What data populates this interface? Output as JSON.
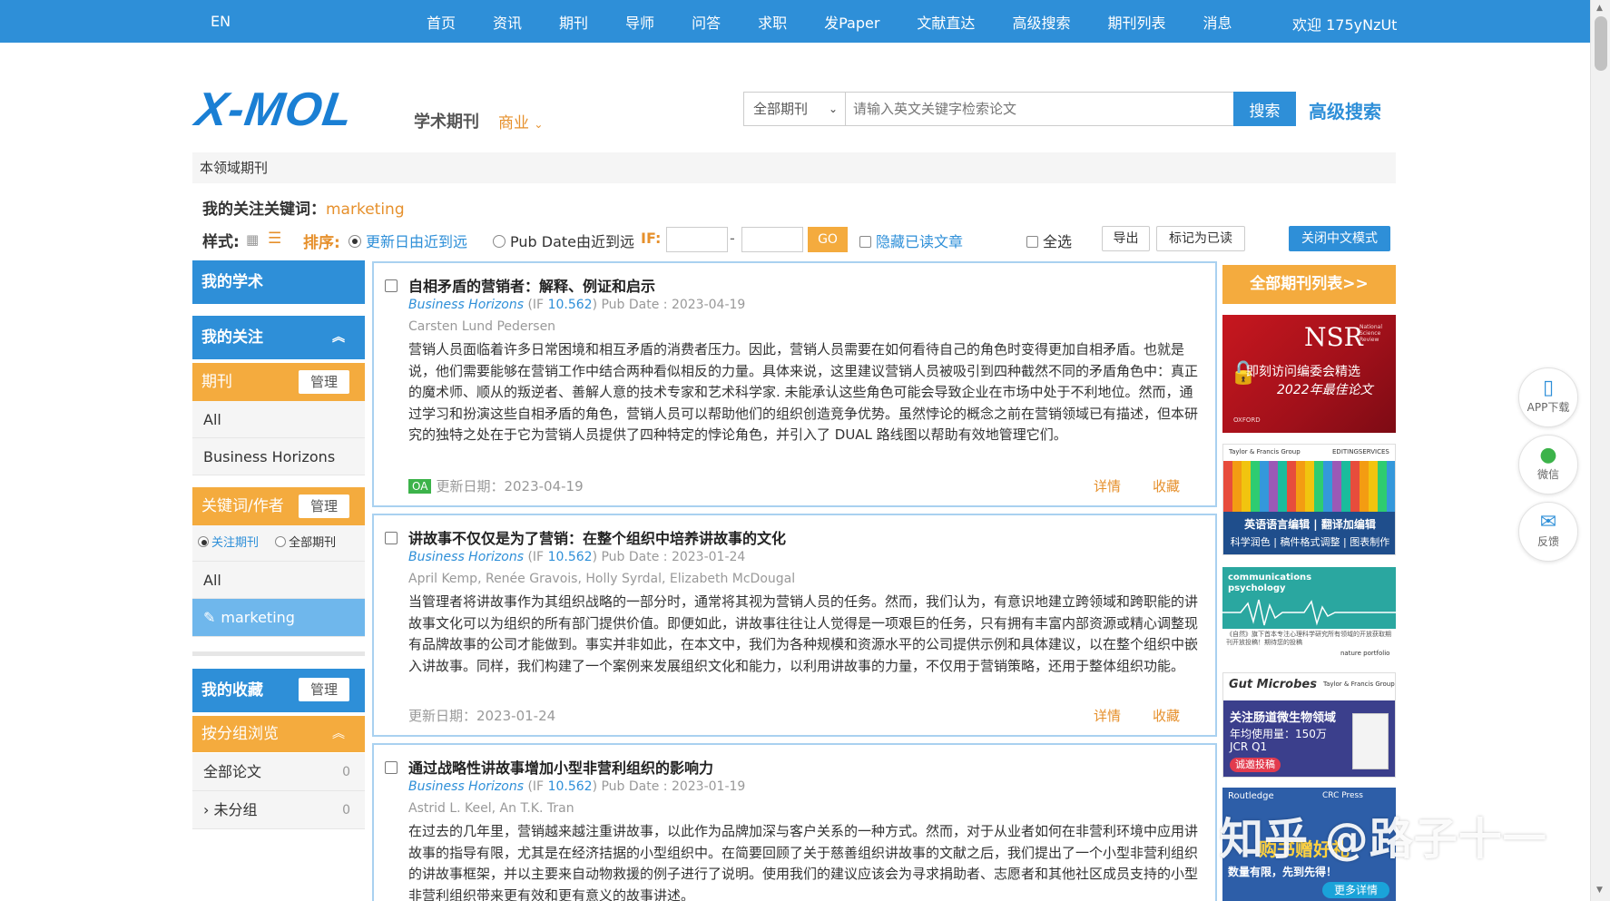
{
  "topnav": {
    "lang": "EN",
    "items": [
      "首页",
      "资讯",
      "期刊",
      "导师",
      "问答",
      "求职",
      "发Paper",
      "文献直达",
      "高级搜索",
      "期刊列表",
      "消息"
    ],
    "welcome": "欢迎 175yNzUt"
  },
  "header": {
    "logo": "X-MOL",
    "subtitle": "学术期刊",
    "category": "商业"
  },
  "search": {
    "scope": "全部期刊",
    "placeholder": "请输入英文关键字检索论文",
    "button": "搜索",
    "advanced": "高级搜索"
  },
  "field_title": "本领域期刊",
  "keyword": {
    "label": "我的关注关键词：",
    "value": "marketing"
  },
  "toolbar": {
    "style_label": "样式:",
    "sort_label": "排序:",
    "sort_update": "更新日由近到远",
    "sort_pub": "Pub Date由近到远",
    "if_label": "IF:",
    "dash": "-",
    "go": "GO",
    "hide_read": "隐藏已读文章",
    "select_all": "全选",
    "export": "导出",
    "mark_read": "标记为已读",
    "close_cn": "关闭中文模式"
  },
  "sidebar": {
    "my_academic": "我的学术",
    "my_follow": "我的关注",
    "journals_label": "期刊",
    "manage": "管理",
    "journal_items": [
      "All",
      "Business Horizons"
    ],
    "kw_label": "关键词/作者",
    "kw_radio_follow": "关注期刊",
    "kw_radio_all": "全部期刊",
    "kw_items": [
      "All",
      "marketing"
    ],
    "favorites": "我的收藏",
    "browse_group": "按分组浏览",
    "groups": [
      {
        "name": "全部论文",
        "count": "0"
      },
      {
        "name": "› 未分组",
        "count": "0"
      }
    ]
  },
  "articles": [
    {
      "title": "自相矛盾的营销者：解释、例证和启示",
      "journal": "Business Horizons",
      "if_prefix": "(IF ",
      "if": "10.562",
      "pub": ") Pub Date : 2023-04-19",
      "authors": "Carsten Lund Pedersen",
      "abstract": "营销人员面临着许多日常困境和相互矛盾的消费者压力。因此，营销人员需要在如何看待自己的角色时变得更加自相矛盾。也就是说，他们需要能够在营销工作中结合两种看似相反的力量。具体来说，这里建议营销人员被吸引到四种截然不同的矛盾角色中：真正的魔术师、顺从的叛逆者、善解人意的技术专家和艺术科学家. 未能承认这些角色可能会导致企业在市场中处于不利地位。然而，通过学习和扮演这些自相矛盾的角色，营销人员可以帮助他们的组织创造竞争优势。虽然悖论的概念之前在营销领域已有描述，但本研究的独特之处在于它为营销人员提供了四种特定的悖论角色，并引入了 DUAL 路线图以帮助有效地管理它们。",
      "oa": "OA",
      "updated": "更新日期：2023-04-19",
      "detail": "详情",
      "fav": "收藏"
    },
    {
      "title": "讲故事不仅仅是为了营销：在整个组织中培养讲故事的文化",
      "journal": "Business Horizons",
      "if_prefix": "(IF ",
      "if": "10.562",
      "pub": ") Pub Date : 2023-01-24",
      "authors": "April Kemp, Renée Gravois, Holly Syrdal, Elizabeth McDougal",
      "abstract": "当管理者将讲故事作为其组织战略的一部分时，通常将其视为营销人员的任务。然而，我们认为，有意识地建立跨领域和跨职能的讲故事文化可以为组织的所有部门提供价值。即便如此，讲故事往往让人觉得是一项艰巨的任务，只有拥有丰富内部资源或精心调整现有品牌故事的公司才能做到。事实并非如此，在本文中，我们为各种规模和资源水平的公司提供示例和具体建议，以在整个组织中嵌入讲故事。同样，我们构建了一个案例来发展组织文化和能力，以利用讲故事的力量，不仅用于营销策略，还用于整体组织功能。",
      "updated": "更新日期：2023-01-24",
      "detail": "详情",
      "fav": "收藏"
    },
    {
      "title": "通过战略性讲故事增加小型非营利组织的影响力",
      "journal": "Business Horizons",
      "if_prefix": "(IF ",
      "if": "10.562",
      "pub": ") Pub Date : 2023-01-19",
      "authors": "Astrid L. Keel, An T.K. Tran",
      "abstract": "在过去的几年里，营销越来越注重讲故事，以此作为品牌加深与客户关系的一种方式。然而，对于从业者如何在非营利环境中应用讲故事的指导有限，尤其是在经济拮据的小型组织中。在简要回顾了关于慈善组织讲故事的文献之后，我们提出了一个小型非营利组织的讲故事框架，并以主要来自动物救援的例子进行了说明。使用我们的建议应该会为寻求捐助者、志愿者和其他社区成员支持的小型非营利组织带来更有效和更有意义的故事讲述。"
    }
  ],
  "right": {
    "all_journals": "全部期刊列表>>",
    "ads": {
      "nsr_title": "NSR",
      "nsr_sub": "National Science Review",
      "nsr_line1": "即刻访问编委会精选",
      "nsr_line2": "2022年最佳论文",
      "nsr_logo": "OXFORD",
      "tf_brand": "Taylor & Francis Group",
      "tf_editing": "EDITINGSERVICES",
      "tf_line1": "英语语言编辑 | 翻译加编辑",
      "tf_line2": "科学润色 | 稿件格式调整 | 图表制作",
      "cp_title": "communications psychology",
      "cp_line": "《自然》旗下首本专注心理科学研究所有领域的开放获取期刊开放投稿！期待您的投稿",
      "cp_brand": "nature portfolio",
      "gm_title": "Gut Microbes",
      "gm_brand": "Taylor & Francis Group",
      "gm_line1": "关注肠道微生物领域",
      "gm_line2": "年均使用量：150万",
      "gm_line3": "JCR Q1",
      "gm_btn": "诚邀投稿",
      "rt_brand1": "Routledge",
      "rt_brand2": "CRC Press",
      "rt_line1": "购书赠好礼",
      "rt_line2": "数量有限，先到先得！",
      "rt_btn": "更多详情"
    }
  },
  "float": {
    "app": "APP下载",
    "wechat": "微信",
    "feedback": "反馈"
  },
  "watermark": "知乎 @路子十一",
  "colors": {
    "primary": "#2e8fd8",
    "accent": "#f4ab3e",
    "link_orange": "#e6902c"
  }
}
